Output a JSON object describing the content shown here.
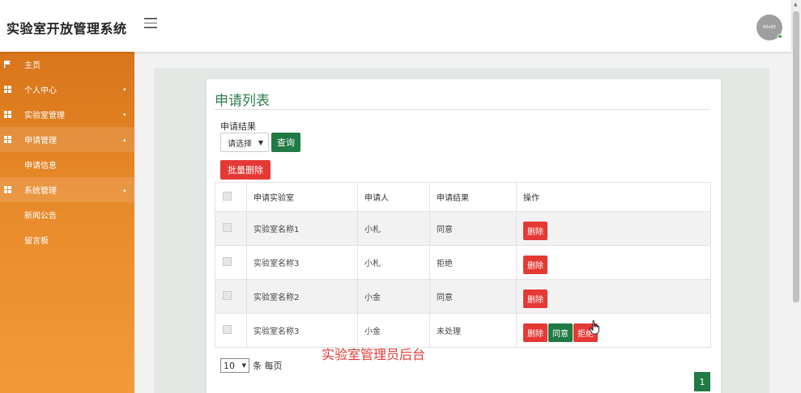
{
  "header": {
    "brand": "实验室开放管理系统",
    "avatar_text": "80x80"
  },
  "sidebar": {
    "items": [
      {
        "label": "主页",
        "icon": "flag-icon",
        "caret": ""
      },
      {
        "label": "个人中心",
        "icon": "grid-icon",
        "caret": "▾"
      },
      {
        "label": "实验室管理",
        "icon": "grid-icon",
        "caret": "▾"
      },
      {
        "label": "申请管理",
        "icon": "grid-icon",
        "caret": "▴"
      },
      {
        "label": "申请信息",
        "sub": true
      },
      {
        "label": "系统管理",
        "icon": "grid-icon",
        "caret": "▴"
      },
      {
        "label": "新闻公告",
        "sub": true
      },
      {
        "label": "留言板",
        "sub": true
      }
    ]
  },
  "main": {
    "title": "申请列表",
    "filter_label": "申请结果",
    "filter_select": "请选择",
    "query_button": "查询",
    "batch_delete_button": "批量删除",
    "table": {
      "headers": [
        "申请实验室",
        "申请人",
        "申请结果",
        "操作"
      ],
      "rows": [
        {
          "lab": "实验室名称1",
          "applicant": "小札",
          "result": "同意"
        },
        {
          "lab": "实验室名称3",
          "applicant": "小札",
          "result": "拒绝"
        },
        {
          "lab": "实验室名称2",
          "applicant": "小金",
          "result": "同意"
        },
        {
          "lab": "实验室名称3",
          "applicant": "小金",
          "result": "未处理"
        }
      ],
      "actions": {
        "delete": "删除",
        "approve": "同意",
        "reject": "拒绝"
      }
    },
    "pager": {
      "page_size": "10",
      "page_size_label": "条 每页",
      "current_page": "1"
    },
    "watermark": "实验室管理员后台"
  },
  "colors": {
    "accent": "#1f7a44",
    "danger": "#e53935",
    "sidebar": "#e88a2a",
    "title": "#2e7d4f"
  }
}
